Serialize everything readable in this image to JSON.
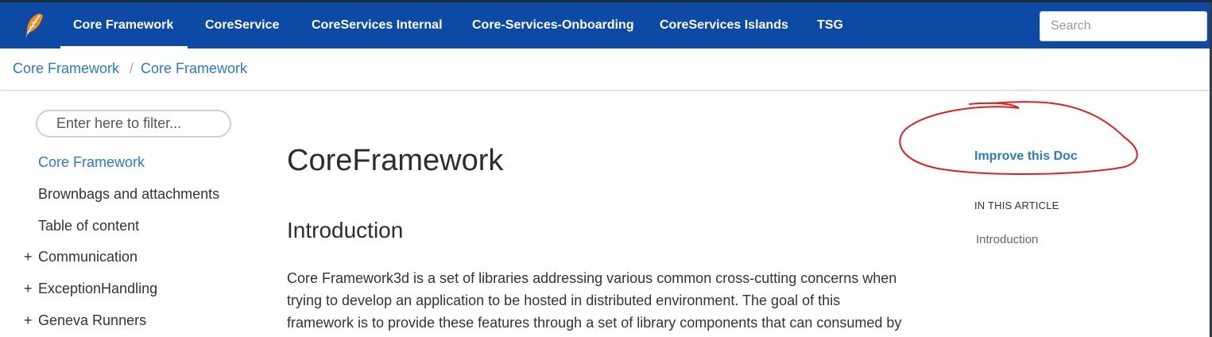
{
  "header": {
    "nav": [
      "Core Framework",
      "CoreService",
      "CoreServices Internal",
      "Core-Services-Onboarding",
      "CoreServices Islands",
      "TSG"
    ],
    "search_placeholder": "Search"
  },
  "breadcrumb": [
    "Core Framework",
    "Core Framework"
  ],
  "breadcrumb_separator": "/",
  "sidebar": {
    "filter_placeholder": "Enter here to filter...",
    "expand_symbol": "+",
    "items": [
      "Core Framework",
      "Brownbags and attachments",
      "Table of content",
      "Communication",
      "ExceptionHandling",
      "Geneva Runners"
    ]
  },
  "article": {
    "title": "CoreFramework",
    "section_heading": "Introduction",
    "lines": [
      "Core Framework3d is a set of libraries addressing various common cross-cutting concerns when",
      "trying to develop an application to be hosted in distributed environment. The goal of this",
      "framework is to provide these features through a set of library components that can consumed by"
    ]
  },
  "aside": {
    "improve_link": "Improve this Doc",
    "in_this_article": "IN THIS ARTICLE",
    "links": [
      "Introduction"
    ]
  },
  "colors": {
    "navbar": "#0c4aa6",
    "link": "#2b7bbf",
    "annotation": "#e02020"
  },
  "icons": [
    "feather-logo-icon"
  ]
}
